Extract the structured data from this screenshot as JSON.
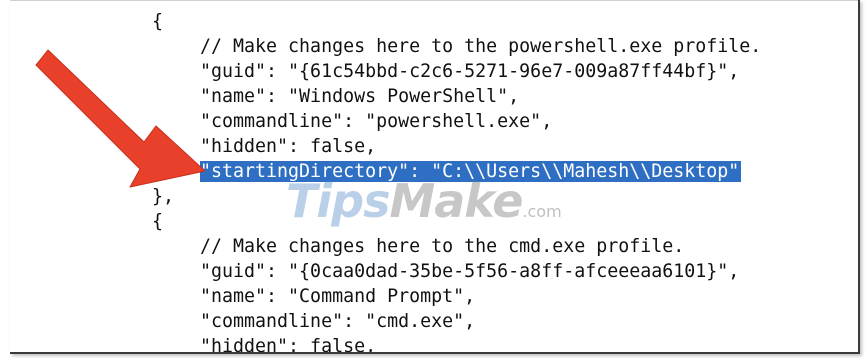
{
  "editor": {
    "lines": [
      "{",
      "// Make changes here to the powershell.exe profile.",
      "\"guid\": \"{61c54bbd-c2c6-5271-96e7-009a87ff44bf}\",",
      "\"name\": \"Windows PowerShell\",",
      "\"commandline\": \"powershell.exe\",",
      "\"hidden\": false,",
      "\"startingDirectory\": \"C:\\\\Users\\\\Mahesh\\\\Desktop\"",
      "},",
      "{",
      "// Make changes here to the cmd.exe profile.",
      "\"guid\": \"{0caa0dad-35be-5f56-a8ff-afceeeaa6101}\",",
      "\"name\": \"Command Prompt\",",
      "\"commandline\": \"cmd.exe\",",
      "\"hidden\": false,"
    ],
    "highlight_color": "#2e6fc3"
  },
  "watermark": {
    "brand_tips": "Tips",
    "brand_make": "Make",
    "brand_com": ".com"
  },
  "annotation": {
    "arrow_color": "#e8402a",
    "arrow_icon": "red-arrow-icon"
  }
}
